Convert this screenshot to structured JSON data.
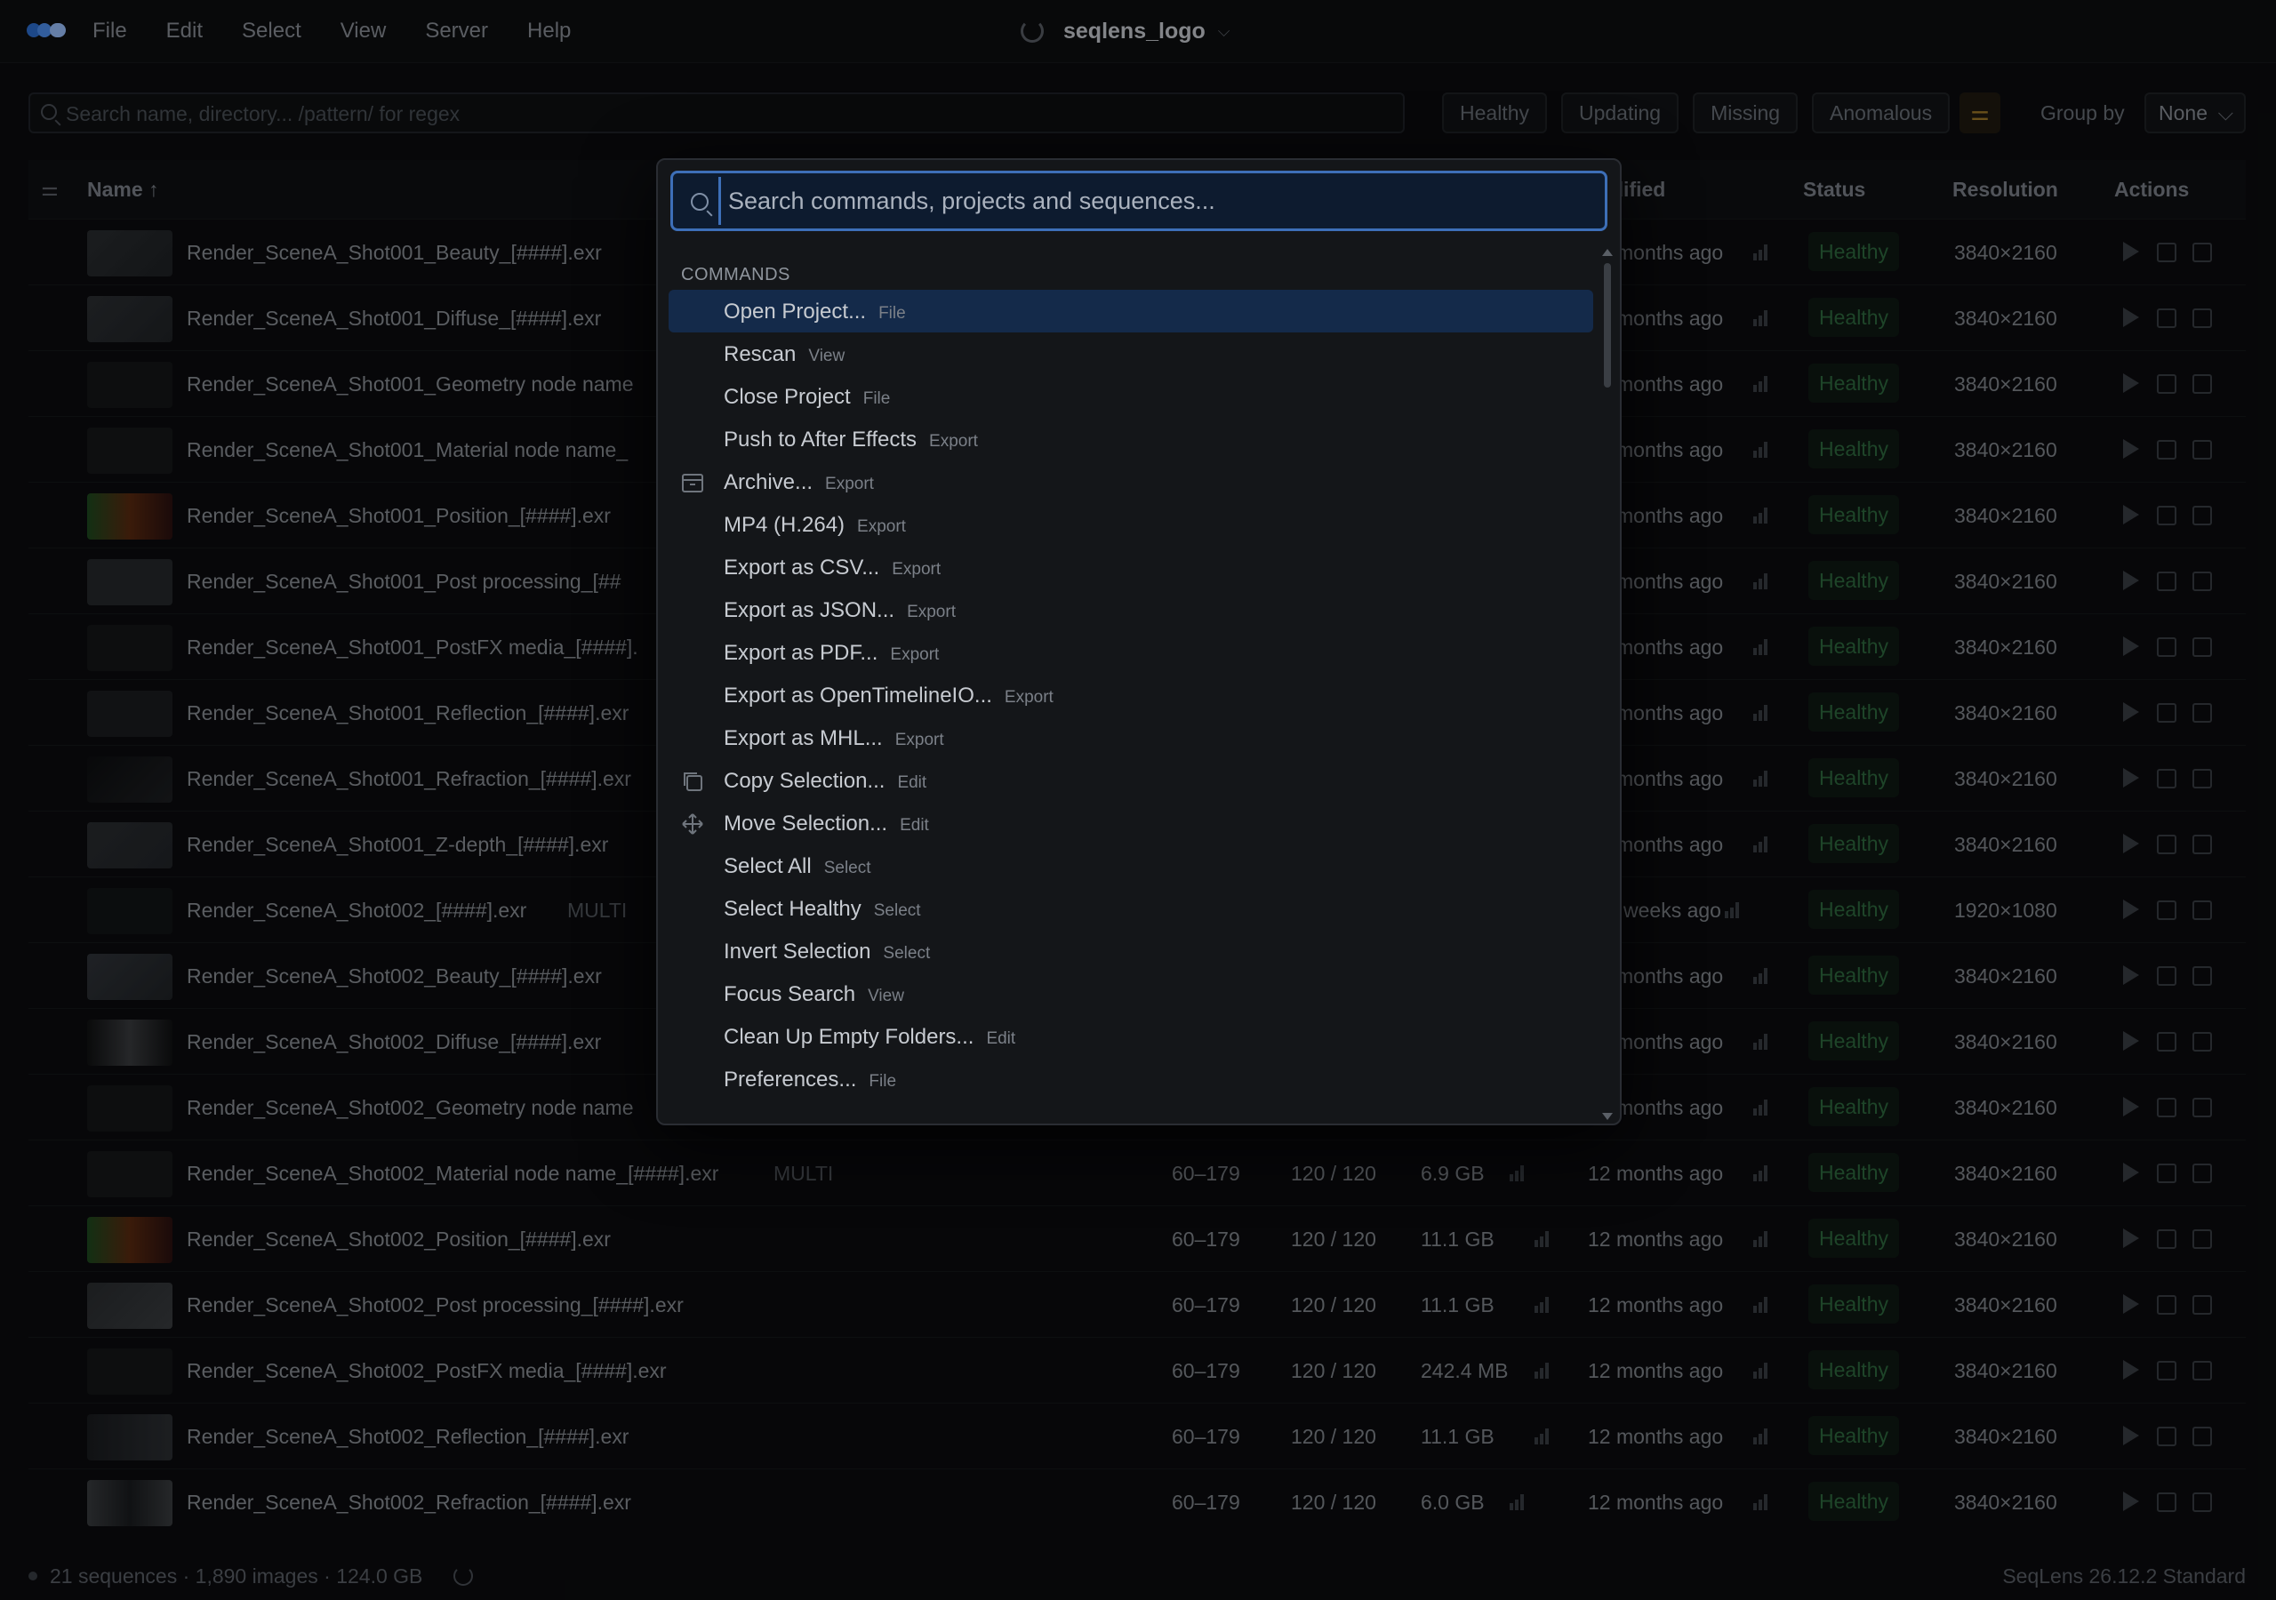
{
  "menu": {
    "items": [
      "File",
      "Edit",
      "Select",
      "View",
      "Server",
      "Help"
    ],
    "project_title": "seqlens_logo"
  },
  "toolbar": {
    "search_placeholder": "Search name, directory... /pattern/ for regex",
    "filters": [
      "Healthy",
      "Updating",
      "Missing",
      "Anomalous"
    ],
    "group_by_label": "Group by",
    "group_by_value": "None"
  },
  "table": {
    "headers": {
      "name": "Name",
      "modified": "dified",
      "status": "Status",
      "resolution": "Resolution",
      "actions": "Actions"
    },
    "rows": [
      {
        "name": "Render_SceneA_Shot001_Beauty_[####].exr",
        "frames": "",
        "count": "",
        "size": "",
        "modified": "months ago",
        "status": "Healthy",
        "resolution": "3840×2160"
      },
      {
        "name": "Render_SceneA_Shot001_Diffuse_[####].exr",
        "frames": "",
        "count": "",
        "size": "",
        "modified": "months ago",
        "status": "Healthy",
        "resolution": "3840×2160"
      },
      {
        "name": "Render_SceneA_Shot001_Geometry node name",
        "frames": "",
        "count": "",
        "size": "",
        "modified": "months ago",
        "status": "Healthy",
        "resolution": "3840×2160"
      },
      {
        "name": "Render_SceneA_Shot001_Material node name_",
        "frames": "",
        "count": "",
        "size": "",
        "modified": "months ago",
        "status": "Healthy",
        "resolution": "3840×2160"
      },
      {
        "name": "Render_SceneA_Shot001_Position_[####].exr",
        "frames": "",
        "count": "",
        "size": "",
        "modified": "months ago",
        "status": "Healthy",
        "resolution": "3840×2160"
      },
      {
        "name": "Render_SceneA_Shot001_Post processing_[##",
        "frames": "",
        "count": "",
        "size": "",
        "modified": "months ago",
        "status": "Healthy",
        "resolution": "3840×2160"
      },
      {
        "name": "Render_SceneA_Shot001_PostFX media_[####].",
        "frames": "",
        "count": "",
        "size": "",
        "modified": "months ago",
        "status": "Healthy",
        "resolution": "3840×2160"
      },
      {
        "name": "Render_SceneA_Shot001_Reflection_[####].exr",
        "frames": "",
        "count": "",
        "size": "",
        "modified": "months ago",
        "status": "Healthy",
        "resolution": "3840×2160"
      },
      {
        "name": "Render_SceneA_Shot001_Refraction_[####].exr",
        "frames": "",
        "count": "",
        "size": "",
        "modified": "months ago",
        "status": "Healthy",
        "resolution": "3840×2160"
      },
      {
        "name": "Render_SceneA_Shot001_Z-depth_[####].exr",
        "frames": "",
        "count": "",
        "size": "",
        "modified": "months ago",
        "status": "Healthy",
        "resolution": "3840×2160"
      },
      {
        "name": "Render_SceneA_Shot002_[####].exr",
        "multi": "MULTI",
        "frames": "",
        "count": "",
        "size": "",
        "modified": "weeks ago",
        "status": "Healthy",
        "resolution": "1920×1080"
      },
      {
        "name": "Render_SceneA_Shot002_Beauty_[####].exr",
        "frames": "",
        "count": "",
        "size": "",
        "modified": "months ago",
        "status": "Healthy",
        "resolution": "3840×2160"
      },
      {
        "name": "Render_SceneA_Shot002_Diffuse_[####].exr",
        "frames": "",
        "count": "",
        "size": "",
        "modified": "months ago",
        "status": "Healthy",
        "resolution": "3840×2160"
      },
      {
        "name": "Render_SceneA_Shot002_Geometry node name",
        "frames": "",
        "count": "",
        "size": "",
        "modified": "months ago",
        "status": "Healthy",
        "resolution": "3840×2160"
      },
      {
        "name": "Render_SceneA_Shot002_Material node name_[####].exr",
        "multi": "MULTI",
        "frames": "60–179",
        "count": "120 / 120",
        "size": "6.9 GB",
        "modified": "12 months ago",
        "status": "Healthy",
        "resolution": "3840×2160"
      },
      {
        "name": "Render_SceneA_Shot002_Position_[####].exr",
        "frames": "60–179",
        "count": "120 / 120",
        "size": "11.1 GB",
        "modified": "12 months ago",
        "status": "Healthy",
        "resolution": "3840×2160"
      },
      {
        "name": "Render_SceneA_Shot002_Post processing_[####].exr",
        "frames": "60–179",
        "count": "120 / 120",
        "size": "11.1 GB",
        "modified": "12 months ago",
        "status": "Healthy",
        "resolution": "3840×2160"
      },
      {
        "name": "Render_SceneA_Shot002_PostFX media_[####].exr",
        "frames": "60–179",
        "count": "120 / 120",
        "size": "242.4 MB",
        "modified": "12 months ago",
        "status": "Healthy",
        "resolution": "3840×2160"
      },
      {
        "name": "Render_SceneA_Shot002_Reflection_[####].exr",
        "frames": "60–179",
        "count": "120 / 120",
        "size": "11.1 GB",
        "modified": "12 months ago",
        "status": "Healthy",
        "resolution": "3840×2160"
      },
      {
        "name": "Render_SceneA_Shot002_Refraction_[####].exr",
        "frames": "60–179",
        "count": "120 / 120",
        "size": "6.0 GB",
        "modified": "12 months ago",
        "status": "Healthy",
        "resolution": "3840×2160"
      }
    ]
  },
  "statusbar": {
    "summary": "21 sequences · 1,890 images · 124.0 GB",
    "version": "SeqLens 26.12.2 Standard"
  },
  "palette": {
    "search_placeholder": "Search commands, projects and sequences...",
    "section_label": "COMMANDS",
    "commands": [
      {
        "label": "Open Project...",
        "category": "File",
        "icon": ""
      },
      {
        "label": "Rescan",
        "category": "View",
        "icon": ""
      },
      {
        "label": "Close Project",
        "category": "File",
        "icon": ""
      },
      {
        "label": "Push to After Effects",
        "category": "Export",
        "icon": ""
      },
      {
        "label": "Archive...",
        "category": "Export",
        "icon": "archive-icon"
      },
      {
        "label": "MP4 (H.264)",
        "category": "Export",
        "icon": ""
      },
      {
        "label": "Export as CSV...",
        "category": "Export",
        "icon": ""
      },
      {
        "label": "Export as JSON...",
        "category": "Export",
        "icon": ""
      },
      {
        "label": "Export as PDF...",
        "category": "Export",
        "icon": ""
      },
      {
        "label": "Export as OpenTimelineIO...",
        "category": "Export",
        "icon": ""
      },
      {
        "label": "Export as MHL...",
        "category": "Export",
        "icon": ""
      },
      {
        "label": "Copy Selection...",
        "category": "Edit",
        "icon": "copy-icon"
      },
      {
        "label": "Move Selection...",
        "category": "Edit",
        "icon": "move-icon"
      },
      {
        "label": "Select All",
        "category": "Select",
        "icon": ""
      },
      {
        "label": "Select Healthy",
        "category": "Select",
        "icon": ""
      },
      {
        "label": "Invert Selection",
        "category": "Select",
        "icon": ""
      },
      {
        "label": "Focus Search",
        "category": "View",
        "icon": ""
      },
      {
        "label": "Clean Up Empty Folders...",
        "category": "Edit",
        "icon": ""
      },
      {
        "label": "Preferences...",
        "category": "File",
        "icon": ""
      }
    ]
  },
  "colors": {
    "accent": "#3d6fb8",
    "selected_row": "#142a4a",
    "healthy": "#2f6a3f"
  }
}
